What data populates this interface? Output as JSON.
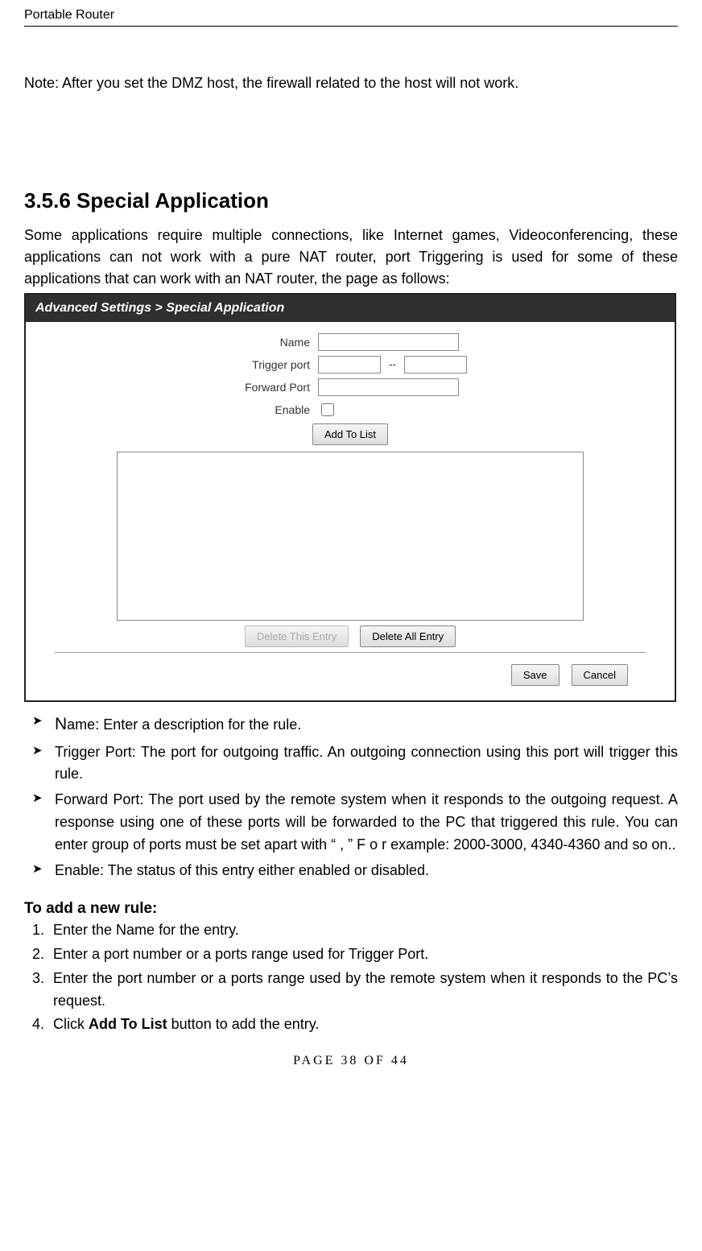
{
  "header": {
    "product": "Portable Router"
  },
  "note": "Note: After you set the DMZ host, the firewall related to the host will not work.",
  "section": {
    "number_title": "3.5.6 Special Application",
    "intro": "Some applications require multiple connections, like Internet games, Videoconferencing, these applications can not work with a pure NAT router, port Triggering is used for some of these applications that can work with an NAT router, the page as follows:"
  },
  "ui": {
    "titlebar": "Advanced Settings > Special Application",
    "labels": {
      "name": "Name",
      "trigger_port": "Trigger port",
      "forward_port": "Forward Port",
      "enable": "Enable",
      "dash": "--"
    },
    "buttons": {
      "add_to_list": "Add To List",
      "delete_this": "Delete This Entry",
      "delete_all": "Delete All Entry",
      "save": "Save",
      "cancel": "Cancel"
    }
  },
  "bullets": {
    "name_first": "N",
    "name_rest": "ame: Enter a description for the rule.",
    "trigger": "Trigger Port: The port for outgoing traffic. An outgoing connection using this port will trigger this rule.",
    "forward": "Forward Port: The port used by the remote system when it responds to the outgoing request. A response using one of these ports will be forwarded to the PC that triggered this rule. You can enter group of ports must be set apart with “ , ” F o r example: 2000-3000, 4340-4360 and so on..",
    "enable": "Enable: The status of this entry either enabled or disabled."
  },
  "addrule": {
    "heading": "To add a new rule:",
    "s1": "Enter the Name for the entry.",
    "s2": "Enter a port number or a ports range used for Trigger Port.",
    "s3": "Enter the port number or a ports range used by the remote system when it responds to the PC’s request.",
    "s4_pre": "Click ",
    "s4_b": "Add To List",
    "s4_post": " button to add the entry."
  },
  "footer": "PAGE  38  OF  44"
}
